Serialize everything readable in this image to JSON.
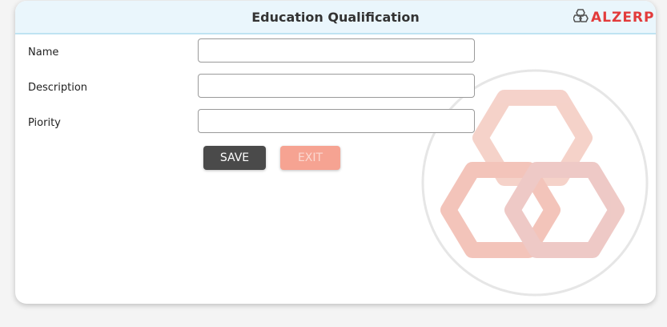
{
  "header": {
    "title": "Education Qualification",
    "brand": "ALZERP"
  },
  "form": {
    "fields": [
      {
        "label": "Name",
        "value": ""
      },
      {
        "label": "Description",
        "value": ""
      },
      {
        "label": "Piority",
        "value": ""
      }
    ],
    "save_label": "SAVE",
    "exit_label": "EXIT"
  },
  "colors": {
    "header_bg": "#eaf6fc",
    "save_bg": "#4a4a4a",
    "exit_bg": "#f6a392",
    "brand_red": "#e23b3b",
    "watermark": "#f0b6a8"
  },
  "icons": {
    "logo": "alzerp-logo-icon",
    "watermark": "alzerp-watermark-icon"
  }
}
